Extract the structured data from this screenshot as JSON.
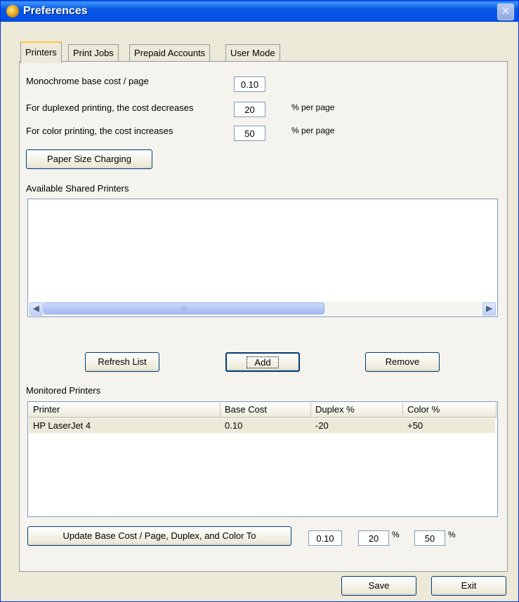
{
  "window": {
    "title": "Preferences",
    "close_glyph": "✕"
  },
  "tabs": [
    {
      "label": "Printers",
      "active": true
    },
    {
      "label": "Print Jobs",
      "active": false
    },
    {
      "label": "Prepaid Accounts",
      "active": false
    },
    {
      "label": "User Mode",
      "active": false
    }
  ],
  "costs": {
    "mono_label": "Monochrome base cost / page",
    "mono_value": "0.10",
    "duplex_label": "For duplexed printing, the cost decreases",
    "duplex_value": "20",
    "duplex_unit": "% per page",
    "color_label": "For color printing, the cost increases",
    "color_value": "50",
    "color_unit": "% per page",
    "paper_button": "Paper Size Charging"
  },
  "available": {
    "label": "Available Shared Printers",
    "items": [],
    "scroll_left": "◀",
    "scroll_right": "▶",
    "thumb_grip": "|||"
  },
  "actions": {
    "refresh": "Refresh List",
    "add": "Add",
    "remove": "Remove"
  },
  "monitored": {
    "label": "Monitored Printers",
    "columns": [
      "Printer",
      "Base Cost",
      "Duplex %",
      "Color %"
    ],
    "rows": [
      {
        "printer": "HP LaserJet 4",
        "base_cost": "0.10",
        "duplex": "-20",
        "color": "+50"
      }
    ]
  },
  "update": {
    "button": "Update  Base Cost / Page, Duplex, and Color To",
    "base_value": "0.10",
    "duplex_value": "20",
    "color_value": "50",
    "percent_sign": "%"
  },
  "footer": {
    "save": "Save",
    "exit": "Exit"
  }
}
